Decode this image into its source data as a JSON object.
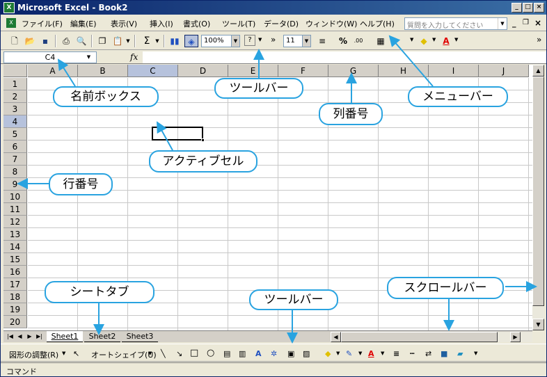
{
  "window": {
    "title": "Microsoft Excel - Book2",
    "icon": "excel-icon",
    "buttons": [
      "_",
      "□",
      "×"
    ]
  },
  "menu": {
    "items": [
      "ファイル(F)",
      "編集(E)",
      "表示(V)",
      "挿入(I)",
      "書式(O)",
      "ツール(T)",
      "データ(D)",
      "ウィンドウ(W)",
      "ヘルプ(H)"
    ],
    "help_placeholder": "質問を入力してください"
  },
  "toolbar": {
    "zoom": "100%",
    "font_size": "11",
    "sigma": "Σ",
    "percent": "%"
  },
  "formula_bar": {
    "name_box": "C4",
    "fx": "fx",
    "content": ""
  },
  "grid": {
    "columns": [
      "A",
      "B",
      "C",
      "D",
      "E",
      "F",
      "G",
      "H",
      "I",
      "J"
    ],
    "rows": [
      "1",
      "2",
      "3",
      "4",
      "5",
      "6",
      "7",
      "8",
      "9",
      "10",
      "11",
      "12",
      "13",
      "14",
      "15",
      "16",
      "17",
      "18",
      "19",
      "20"
    ],
    "active_column": "C",
    "active_row": "4"
  },
  "sheets": [
    "Sheet1",
    "Sheet2",
    "Sheet3"
  ],
  "active_sheet": "Sheet1",
  "draw_toolbar": {
    "adjust": "図形の調整(R)",
    "autoshape": "オートシェイプ(U)"
  },
  "status": {
    "mode": "コマンド"
  },
  "callouts": {
    "name_box": "名前ボックス",
    "toolbar_top": "ツールバー",
    "menu_bar": "メニューバー",
    "column_number": "列番号",
    "active_cell": "アクティブセル",
    "row_number": "行番号",
    "sheet_tab": "シートタブ",
    "toolbar_bottom": "ツールバー",
    "scroll_bar": "スクロールバー"
  },
  "colors": {
    "callout_border": "#29a3e0",
    "arrow": "#29a3e0",
    "title_bar": "#0a246a"
  }
}
